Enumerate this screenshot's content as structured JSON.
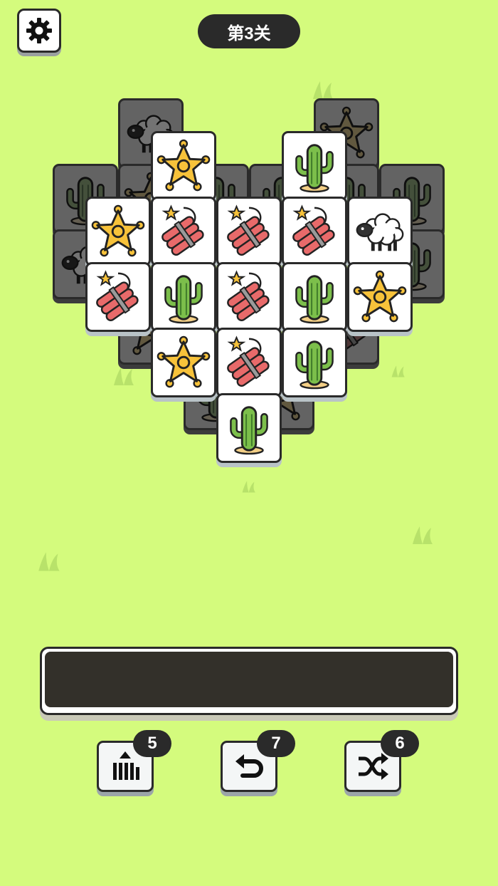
{
  "header": {
    "level_label": "第3关"
  },
  "board": {
    "top_rows": [
      [
        "star",
        "cactus"
      ],
      [
        "star",
        "dynamite",
        "dynamite",
        "dynamite",
        "sheep"
      ],
      [
        "dynamite",
        "cactus",
        "dynamite",
        "cactus",
        "star"
      ],
      [
        "star",
        "dynamite",
        "cactus"
      ],
      [
        "cactus"
      ]
    ]
  },
  "tools": [
    {
      "name": "move-out",
      "count": "5"
    },
    {
      "name": "undo",
      "count": "7"
    },
    {
      "name": "shuffle",
      "count": "6"
    }
  ]
}
